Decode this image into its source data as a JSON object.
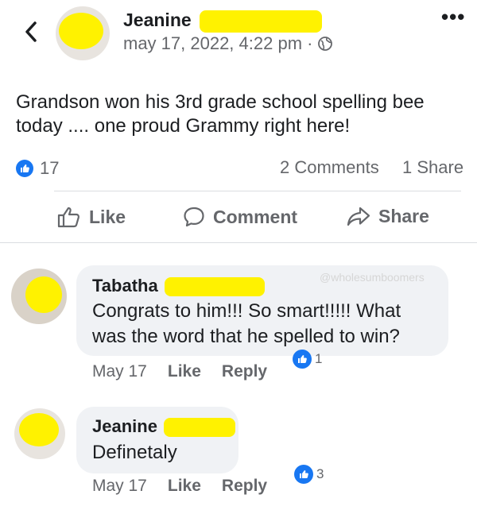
{
  "header": {
    "back_icon": "chevron-left-icon",
    "author": "Jeanine",
    "timestamp": "may 17, 2022, 4:22 pm ·",
    "privacy_icon": "globe-icon",
    "more_label": "•••"
  },
  "post": {
    "text": "Grandson won his 3rd grade school spelling bee today .... one proud Grammy right here!",
    "reaction_count": "17",
    "comments_count": "2 Comments",
    "shares_count": "1 Share"
  },
  "actions": {
    "like": "Like",
    "comment": "Comment",
    "share": "Share"
  },
  "comments": [
    {
      "author": "Tabatha",
      "text": "Congrats to him!!! So smart!!!!! What was the word that he spelled to win?",
      "date": "May 17",
      "like": "Like",
      "reply": "Reply",
      "reactions": "1"
    },
    {
      "author": "Jeanine",
      "text": "Definetaly",
      "date": "May 17",
      "like": "Like",
      "reply": "Reply",
      "reactions": "3"
    }
  ],
  "watermark": "@wholesumboomers",
  "colors": {
    "accent": "#1877f2",
    "highlight": "#fff200",
    "muted": "#65676b",
    "bubble": "#f0f2f5"
  }
}
